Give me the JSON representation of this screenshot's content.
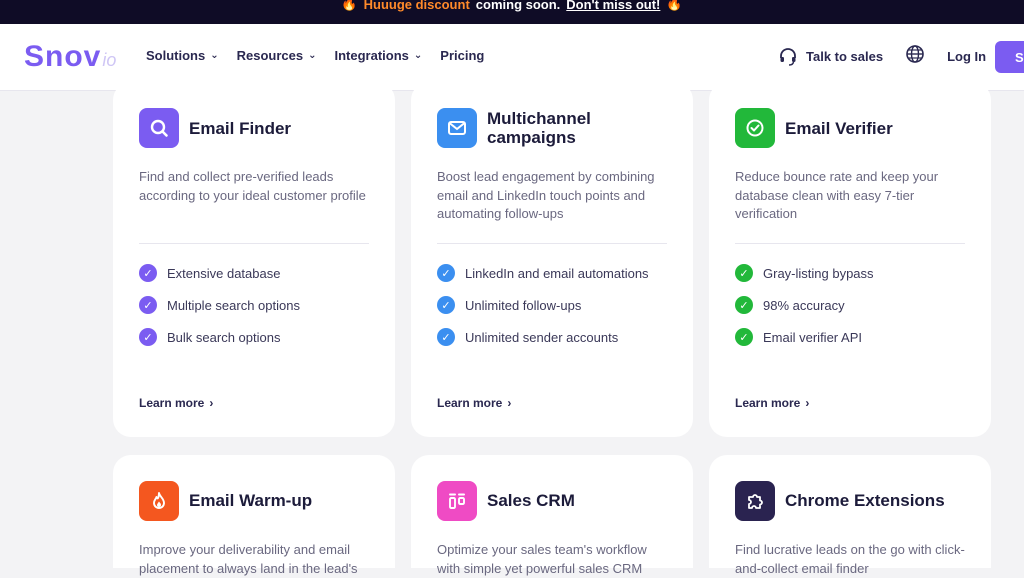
{
  "promo": {
    "highlight": "Huuuge discount",
    "text": "coming soon.",
    "link": "Don't miss out!"
  },
  "nav": {
    "logo_main": "Snov",
    "logo_sub": "io",
    "menu": [
      {
        "label": "Solutions"
      },
      {
        "label": "Resources"
      },
      {
        "label": "Integrations"
      },
      {
        "label": "Pricing"
      }
    ],
    "talk_to_sales": "Talk to sales",
    "login": "Log In",
    "cta": "S"
  },
  "cards": [
    {
      "title": "Email Finder",
      "icon": "magnifier-icon",
      "color": "#7b5cf1",
      "desc": "Find and collect pre-verified leads according to your ideal customer profile",
      "features": [
        "Extensive database",
        "Multiple search options",
        "Bulk search options"
      ],
      "learn_more": "Learn more"
    },
    {
      "title": "Multichannel campaigns",
      "icon": "envelope-icon",
      "color": "#3b8ff0",
      "desc": "Boost lead engagement by combining email and LinkedIn touch points and automating follow-ups",
      "features": [
        "LinkedIn and email automations",
        "Unlimited follow-ups",
        "Unlimited sender accounts"
      ],
      "learn_more": "Learn more"
    },
    {
      "title": "Email Verifier",
      "icon": "check-circle-icon",
      "color": "#22b83a",
      "desc": "Reduce bounce rate and keep your database clean with easy 7-tier verification",
      "features": [
        "Gray-listing bypass",
        "98% accuracy",
        "Email verifier API"
      ],
      "learn_more": "Learn more"
    },
    {
      "title": "Email Warm-up",
      "icon": "flame-icon",
      "color": "#f4571f",
      "desc": "Improve your deliverability and email placement to always land in the lead's"
    },
    {
      "title": "Sales CRM",
      "icon": "crm-icon",
      "color": "#ef4bc4",
      "desc": "Optimize your sales team's workflow with simple yet powerful sales CRM"
    },
    {
      "title": "Chrome Extensions",
      "icon": "puzzle-icon",
      "color": "#2a2350",
      "desc": "Find lucrative leads on the go with click-and-collect email finder"
    }
  ]
}
